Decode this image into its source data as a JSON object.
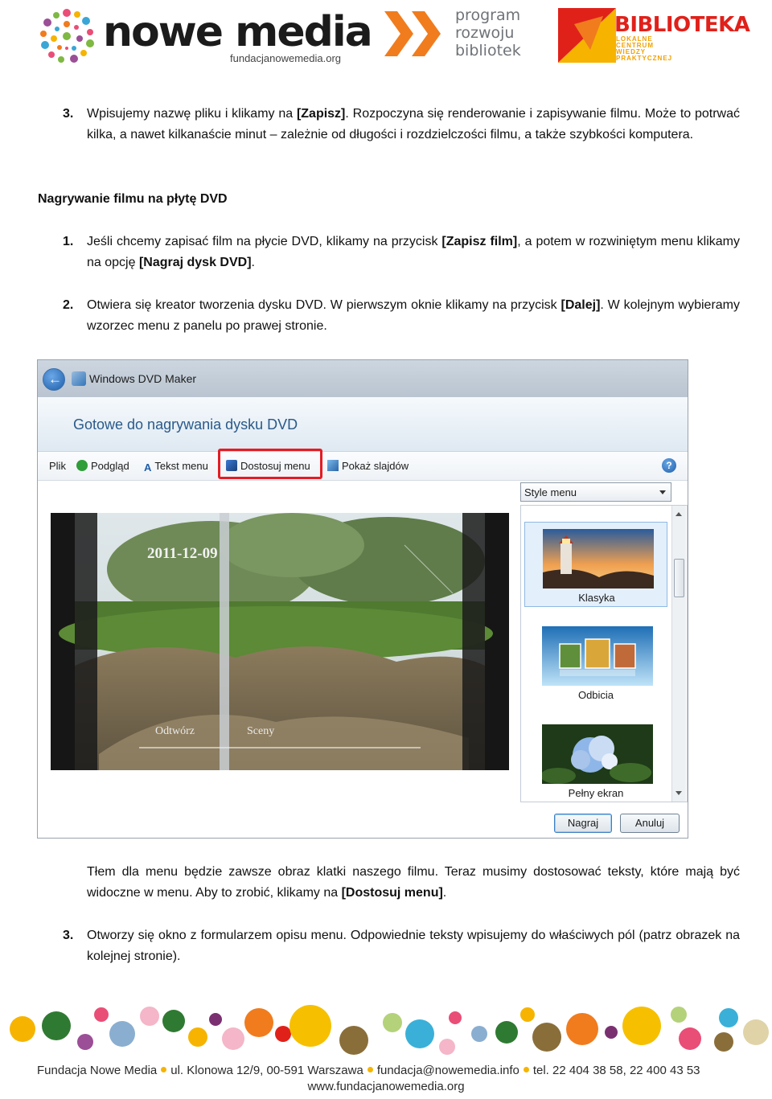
{
  "header": {
    "nowe_media_word": "nowe media",
    "nowe_media_url": "fundacjanowemedia.org",
    "program_lines": [
      "program",
      "rozwoju",
      "bibliotek"
    ],
    "biblioteka_title": "BIBLIOTEKA",
    "biblioteka_sub_lines": [
      "LOKALNE",
      "CENTRUM",
      "WIEDZY",
      "PRAKTYCZNEJ"
    ]
  },
  "doc": {
    "step3a": {
      "num": "3.",
      "pre": "Wpisujemy nazwę pliku i klikamy na ",
      "bold": "[Zapisz]",
      "post": ". Rozpoczyna się renderowanie i zapisywanie filmu. Może to potrwać kilka, a nawet kilkanaście minut – zależnie od długości i rozdzielczości filmu, a także szybkości komputera."
    },
    "heading": "Nagrywanie filmu na płytę DVD",
    "step1": {
      "num": "1.",
      "pre": "Jeśli chcemy zapisać film na płycie DVD, klikamy na przycisk ",
      "bold1": "[Zapisz film]",
      "mid": ", a potem w rozwiniętym menu klikamy na opcję ",
      "bold2": "[Nagraj dysk DVD]",
      "post": "."
    },
    "step2": {
      "num": "2.",
      "pre": "Otwiera się kreator tworzenia dysku DVD. W pierwszym oknie klikamy na przycisk ",
      "bold": "[Dalej]",
      "post": ". W kolejnym wybieramy wzorzec menu z panelu po prawej stronie."
    },
    "after_shot": {
      "pre": "Tłem dla menu będzie zawsze obraz klatki naszego filmu. Teraz musimy dostosować teksty, które mają być widoczne w menu. Aby to zrobić, klikamy na ",
      "bold": "[Dostosuj menu]",
      "post": "."
    },
    "step3b": {
      "num": "3.",
      "text": "Otworzy się okno z formularzem opisu menu. Odpowiednie teksty wpisujemy do właściwych pól (patrz obrazek na kolejnej stronie)."
    }
  },
  "window": {
    "app_title": "Windows DVD Maker",
    "back_icon": "back-arrow-icon",
    "page_heading": "Gotowe do nagrywania dysku DVD",
    "toolbar": {
      "file": "Plik",
      "preview": "Podgląd",
      "menu_text": "Tekst menu",
      "customize_menu": "Dostosuj menu",
      "slideshow": "Pokaż slajdów",
      "help": "?"
    },
    "preview": {
      "date_label": "2011-12-09",
      "play_label": "Odtwórz",
      "scenes_label": "Sceny"
    },
    "style_select": "Style menu",
    "styles": [
      {
        "name": "Klasyka",
        "selected": true
      },
      {
        "name": "Odbicia",
        "selected": false
      },
      {
        "name": "Pełny ekran",
        "selected": false
      }
    ],
    "buttons": {
      "burn": "Nagraj",
      "cancel": "Anuluj"
    },
    "highlight_color": "#e41c24"
  },
  "footer": {
    "org": "Fundacja Nowe Media",
    "address": "ul. Klonowa 12/9, 00-591 Warszawa",
    "email": "fundacja@nowemedia.info",
    "phone": "tel. 22 404 38 58, 22 400 43 53",
    "website": "www.fundacjanowemedia.org"
  },
  "colors": {
    "accent_orange": "#f07c1e",
    "biblioteka_red": "#e0211a",
    "footer_dot": "#f6b400"
  }
}
